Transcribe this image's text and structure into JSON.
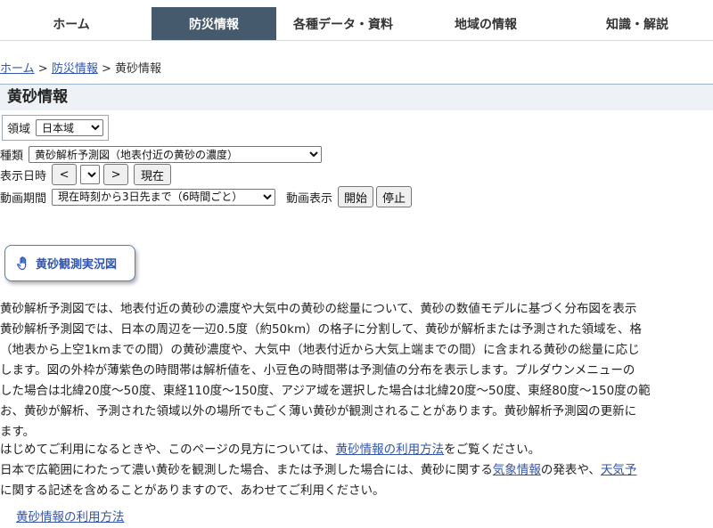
{
  "nav": {
    "items": [
      {
        "label": "ホーム"
      },
      {
        "label": "防災情報"
      },
      {
        "label": "各種データ・資料"
      },
      {
        "label": "地域の情報"
      },
      {
        "label": "知識・解説"
      }
    ],
    "active_index": 1,
    "active_color": "#465a6e"
  },
  "breadcrumb": {
    "home": "ホーム",
    "sep": ">",
    "bosai": "防災情報",
    "current": "黄砂情報"
  },
  "page_title": "黄砂情報",
  "controls": {
    "region_label": "領域",
    "region_value": "日本域",
    "type_label": "種類",
    "type_value": "黄砂解析予測図（地表付近の黄砂の濃度）",
    "datetime_label": "表示日時",
    "prev_button": "<",
    "next_button": ">",
    "now_button": "現在",
    "period_label": "動画期間",
    "period_value": "現在時刻から3日先まで（6時間ごと）",
    "anim_label": "動画表示",
    "start_button": "開始",
    "stop_button": "停止"
  },
  "obs_button": {
    "label": "黄砂観測実況図",
    "icon": "hand-pointer-icon"
  },
  "description": {
    "lines": [
      "黄砂解析予測図では、地表付近の黄砂の濃度や大気中の黄砂の総量について、黄砂の数値モデルに基づく分布図を表示",
      "黄砂解析予測図では、日本の周辺を一辺0.5度（約50km）の格子に分割して、黄砂が解析または予測された領域を、格",
      "（地表から上空1kmまでの間）の黄砂濃度や、大気中（地表付近から大気上端までの間）に含まれる黄砂の総量に応じ",
      "します。図の外枠が薄紫色の時間帯は解析値を、小豆色の時間帯は予測値の分布を表示します。プルダウンメニューの",
      "した場合は北緯20度〜50度、東経110度〜150度、アジア域を選択した場合は北緯20度〜50度、東経80度〜150度の範",
      "お、黄砂が解析、予測された領域以外の場所でもごく薄い黄砂が観測されることがあります。黄砂解析予測図の更新に",
      "ます。"
    ]
  },
  "notes": {
    "line1_pre": "はじめてご利用になるときや、このページの見方については、",
    "line1_link": "黄砂情報の利用方法",
    "line1_post": "をご覧ください。",
    "line2_pre": "日本で広範囲にわたって濃い黄砂を観測した場合、または予測した場合には、黄砂に関する",
    "line2_link1": "気象情報",
    "line2_mid": "の発表や、",
    "line2_link2": "天気予",
    "line3": "に関する記述を含めることがありますので、あわせてご利用ください。"
  },
  "bottom_link": "黄砂情報の利用方法"
}
